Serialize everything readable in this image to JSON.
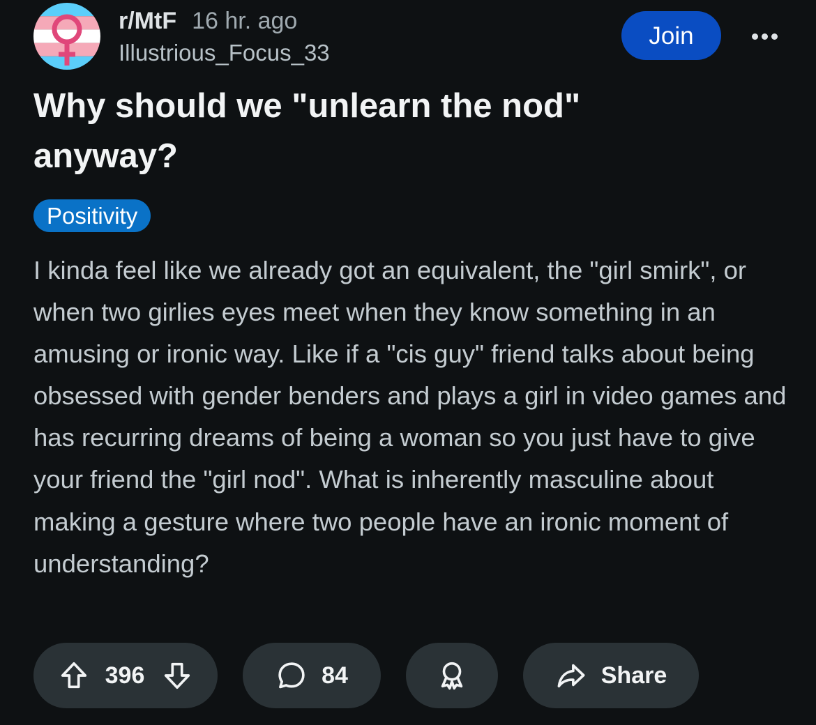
{
  "post": {
    "subreddit": "r/MtF",
    "time_ago": "16 hr. ago",
    "author": "Illustrious_Focus_33",
    "join_label": "Join",
    "title": "Why should we \"unlearn the nod\" anyway?",
    "flair": "Positivity",
    "body": "I kinda feel like we already got an equivalent, the \"girl smirk\", or when two girlies eyes meet when they know something in an amusing or ironic way. Like if a \"cis guy\" friend talks about being obsessed with gender benders and plays a girl in video games and has recurring dreams of being a woman so you just have to give your friend the \"girl nod\". What is inherently masculine about making a gesture where two people have an ironic moment of understanding?"
  },
  "actions": {
    "upvotes": "396",
    "comments": "84",
    "share_label": "Share"
  },
  "icons": {
    "subreddit_avatar": "trans-flag-female-symbol-icon",
    "more": "more-options-icon",
    "upvote": "upvote-arrow-icon",
    "downvote": "downvote-arrow-icon",
    "comment": "comment-bubble-icon",
    "award": "award-ribbon-icon",
    "share": "share-arrow-icon"
  },
  "colors": {
    "background": "#0e1113",
    "join_button": "#0a4dc2",
    "flair": "#0a72c7",
    "action_pill": "#2a3236",
    "trans_blue": "#5bcefa",
    "trans_pink": "#f5a9b8",
    "symbol_pink": "#e0477a"
  }
}
